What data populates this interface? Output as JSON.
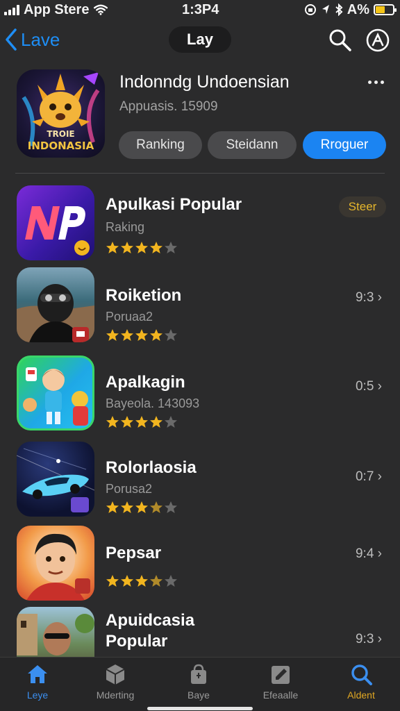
{
  "status": {
    "carrier": "App Stere",
    "time": "1:3P4",
    "battery": "A%"
  },
  "nav": {
    "back_label": "Lave",
    "title": "Lay"
  },
  "header": {
    "title": "Indonndg Undoensian",
    "subtitle": "Appuasis. 15909",
    "logo_line1": "TROIE",
    "logo_line2": "INDONASIA",
    "segments": [
      "Ranking",
      "Steidann",
      "Rroguer"
    ],
    "active_segment": 2
  },
  "apps": [
    {
      "name": "Apulkasi Popular",
      "sub": "Raking",
      "rating": 4,
      "meta": "",
      "badge": "Steer",
      "star_color": "#f2b51f"
    },
    {
      "name": "Roiketion",
      "sub": "Poruaa2",
      "rating": 4,
      "meta": "9:3 ›",
      "badge": "",
      "star_color": "#f2b51f"
    },
    {
      "name": "Apalkagin",
      "sub": "Bayeola. 143093",
      "rating": 4,
      "meta": "0:5 ›",
      "badge": "",
      "star_color": "#f2b51f"
    },
    {
      "name": "Rolorlaosia",
      "sub": "Porusa2",
      "rating": 3.5,
      "meta": "0:7 ›",
      "badge": "",
      "star_color": "#f2b51f"
    },
    {
      "name": "Pepsar",
      "sub": "",
      "rating": 3.5,
      "meta": "9:4 ›",
      "badge": "",
      "star_color": "#f2b51f"
    },
    {
      "name_line1": "Apuidcasia",
      "name_line2": "Popular",
      "meta": "9:3 ›"
    }
  ],
  "tabs": [
    {
      "label": "Leye",
      "icon": "home-icon"
    },
    {
      "label": "Mderting",
      "icon": "box-icon"
    },
    {
      "label": "Baye",
      "icon": "bag-icon"
    },
    {
      "label": "Efeaalle",
      "icon": "edit-icon"
    },
    {
      "label": "Aldent",
      "icon": "search-icon"
    }
  ],
  "colors": {
    "accent": "#1b84f2",
    "star": "#f2b51f",
    "badge_text": "#e6b62c"
  }
}
